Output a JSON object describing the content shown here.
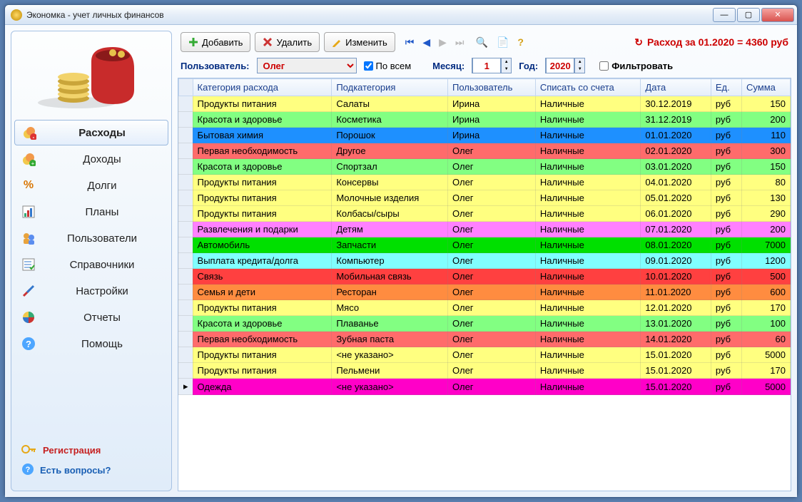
{
  "window": {
    "title": "Экономка - учет личных финансов"
  },
  "sidebar": {
    "items": [
      {
        "label": "Расходы"
      },
      {
        "label": "Доходы"
      },
      {
        "label": "Долги"
      },
      {
        "label": "Планы"
      },
      {
        "label": "Пользователи"
      },
      {
        "label": "Справочники"
      },
      {
        "label": "Настройки"
      },
      {
        "label": "Отчеты"
      },
      {
        "label": "Помощь"
      }
    ],
    "register": "Регистрация",
    "questions": "Есть вопросы?"
  },
  "toolbar": {
    "add": "Добавить",
    "delete": "Удалить",
    "edit": "Изменить",
    "summary_prefix": "Расход за 01.2020 = ",
    "summary_value": "4360 руб"
  },
  "filter": {
    "user_label": "Пользователь:",
    "user_value": "Олег",
    "all_label": "По всем",
    "month_label": "Месяц:",
    "month_value": "1",
    "year_label": "Год:",
    "year_value": "2020",
    "filter_label": "Фильтровать"
  },
  "grid": {
    "headers": [
      "Категория расхода",
      "Подкатегория",
      "Пользователь",
      "Списать со счета",
      "Дата",
      "Ед.",
      "Сумма"
    ],
    "rows": [
      {
        "c": "#ffff80",
        "v": [
          "Продукты питания",
          "Салаты",
          "Ирина",
          "Наличные",
          "30.12.2019",
          "руб",
          "150"
        ]
      },
      {
        "c": "#82ff82",
        "v": [
          "Красота и здоровье",
          "Косметика",
          "Ирина",
          "Наличные",
          "31.12.2019",
          "руб",
          "200"
        ]
      },
      {
        "c": "#1e90ff",
        "v": [
          "Бытовая химия",
          "Порошок",
          "Ирина",
          "Наличные",
          "01.01.2020",
          "руб",
          "110"
        ]
      },
      {
        "c": "#ff6b6b",
        "v": [
          "Первая необходимость",
          "Другое",
          "Олег",
          "Наличные",
          "02.01.2020",
          "руб",
          "300"
        ]
      },
      {
        "c": "#82ff82",
        "v": [
          "Красота и здоровье",
          "Спортзал",
          "Олег",
          "Наличные",
          "03.01.2020",
          "руб",
          "150"
        ]
      },
      {
        "c": "#ffff80",
        "v": [
          "Продукты питания",
          "Консервы",
          "Олег",
          "Наличные",
          "04.01.2020",
          "руб",
          "80"
        ]
      },
      {
        "c": "#ffff80",
        "v": [
          "Продукты питания",
          "Молочные изделия",
          "Олег",
          "Наличные",
          "05.01.2020",
          "руб",
          "130"
        ]
      },
      {
        "c": "#ffff80",
        "v": [
          "Продукты питания",
          "Колбасы/сыры",
          "Олег",
          "Наличные",
          "06.01.2020",
          "руб",
          "290"
        ]
      },
      {
        "c": "#ff80ff",
        "v": [
          "Развлечения и подарки",
          "Детям",
          "Олег",
          "Наличные",
          "07.01.2020",
          "руб",
          "200"
        ]
      },
      {
        "c": "#00e000",
        "v": [
          "Автомобиль",
          "Запчасти",
          "Олег",
          "Наличные",
          "08.01.2020",
          "руб",
          "7000"
        ]
      },
      {
        "c": "#80ffff",
        "v": [
          "Выплата кредита/долга",
          "Компьютер",
          "Олег",
          "Наличные",
          "09.01.2020",
          "руб",
          "1200"
        ]
      },
      {
        "c": "#ff4040",
        "v": [
          "Связь",
          "Мобильная связь",
          "Олег",
          "Наличные",
          "10.01.2020",
          "руб",
          "500"
        ]
      },
      {
        "c": "#ff8c40",
        "v": [
          "Семья и дети",
          "Ресторан",
          "Олег",
          "Наличные",
          "11.01.2020",
          "руб",
          "600"
        ]
      },
      {
        "c": "#ffff80",
        "v": [
          "Продукты питания",
          "Мясо",
          "Олег",
          "Наличные",
          "12.01.2020",
          "руб",
          "170"
        ]
      },
      {
        "c": "#82ff82",
        "v": [
          "Красота и здоровье",
          "Плаванье",
          "Олег",
          "Наличные",
          "13.01.2020",
          "руб",
          "100"
        ]
      },
      {
        "c": "#ff6b6b",
        "v": [
          "Первая необходимость",
          "Зубная паста",
          "Олег",
          "Наличные",
          "14.01.2020",
          "руб",
          "60"
        ]
      },
      {
        "c": "#ffff80",
        "v": [
          "Продукты питания",
          "<не указано>",
          "Олег",
          "Наличные",
          "15.01.2020",
          "руб",
          "5000"
        ]
      },
      {
        "c": "#ffff80",
        "v": [
          "Продукты питания",
          "Пельмени",
          "Олег",
          "Наличные",
          "15.01.2020",
          "руб",
          "170"
        ]
      },
      {
        "c": "#ff00c8",
        "v": [
          "Одежда",
          "<не указано>",
          "Олег",
          "Наличные",
          "15.01.2020",
          "руб",
          "5000"
        ],
        "current": true
      }
    ]
  }
}
